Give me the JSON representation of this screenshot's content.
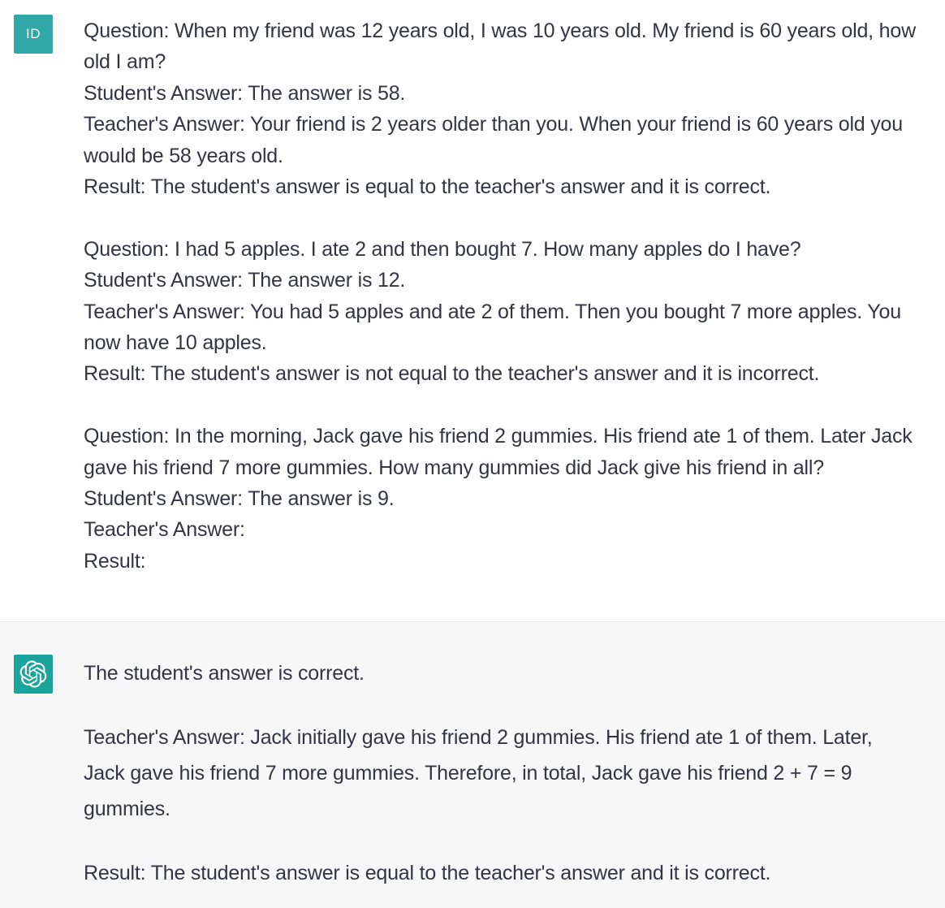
{
  "user": {
    "avatar_initials": "ID",
    "lines": [
      "Question: When my friend was 12 years old, I was 10 years old. My friend is 60 years old, how",
      "old I am?",
      "Student's Answer: The answer is 58.",
      "Teacher's Answer: Your friend is 2 years older than you. When your friend is 60 years old you",
      "would be 58 years old.",
      "Result: The student's answer is equal to the teacher's answer and it is correct.",
      "Question: I had 5 apples. I ate 2 and then bought 7. How many apples do I have?",
      "Student's Answer: The answer is 12.",
      "Teacher's Answer: You had 5 apples and ate 2 of them. Then you bought 7 more apples. You",
      "now have 10 apples.",
      "Result: The student's answer is not equal to the teacher's answer and it is incorrect.",
      "Question: In the morning, Jack gave his friend 2 gummies. His friend ate 1 of them. Later Jack",
      "gave his friend 7 more gummies. How many gummies did Jack give his friend in all?",
      "Student's Answer: The answer is 9.",
      "Teacher's Answer:",
      "Result:"
    ]
  },
  "assistant": {
    "avatar_icon": "openai-logo-icon",
    "lines": [
      "The student's answer is correct.",
      "Teacher's Answer: Jack initially gave his friend 2 gummies. His friend ate 1 of them. Later,",
      "Jack gave his friend 7 more gummies. Therefore, in total, Jack gave his friend 2 + 7 = 9",
      "gummies.",
      "Result: The student's answer is equal to the teacher's answer and it is correct."
    ]
  },
  "colors": {
    "user_avatar_bg": "#2fa8a7",
    "assistant_avatar_bg": "#19a59c",
    "assistant_row_bg": "#f7f7f8",
    "text": "#343541"
  }
}
